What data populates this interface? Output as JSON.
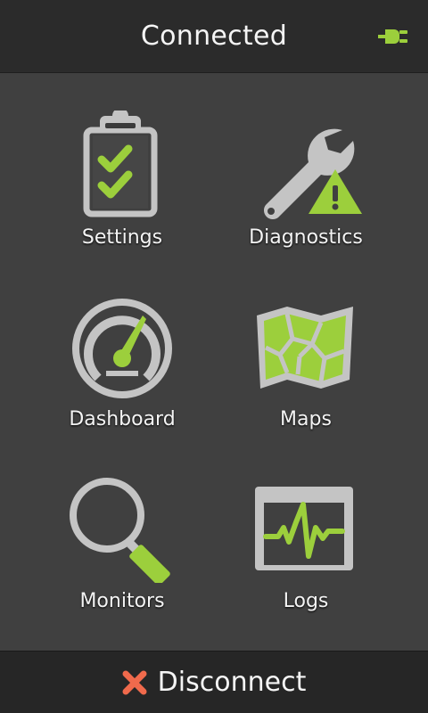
{
  "header": {
    "title": "Connected",
    "status_icon": "plug-icon"
  },
  "menu": {
    "items": [
      {
        "label": "Settings",
        "icon": "clipboard-checklist-icon"
      },
      {
        "label": "Diagnostics",
        "icon": "wrench-warning-icon"
      },
      {
        "label": "Dashboard",
        "icon": "gauge-icon"
      },
      {
        "label": "Maps",
        "icon": "map-icon"
      },
      {
        "label": "Monitors",
        "icon": "magnifier-icon"
      },
      {
        "label": "Logs",
        "icon": "waveform-log-icon"
      }
    ]
  },
  "footer": {
    "disconnect_label": "Disconnect",
    "disconnect_icon": "close-icon"
  },
  "colors": {
    "accent": "#9ccf3c",
    "icon_gray": "#c4c4c4",
    "topbar": "#2b2b2b",
    "background": "#404040",
    "danger": "#f06a4c"
  }
}
